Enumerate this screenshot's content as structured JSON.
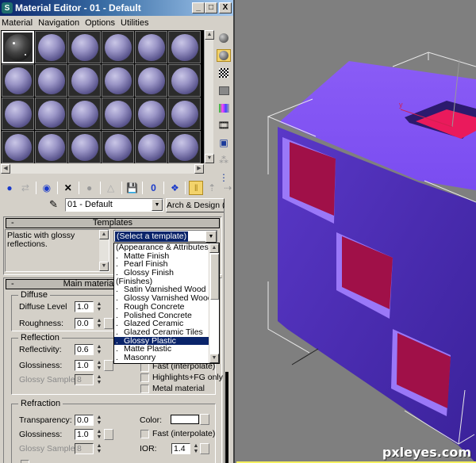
{
  "window": {
    "app_icon": "3ds-max-icon",
    "title": "Material Editor - 01 - Default",
    "buttons": {
      "minimize": "_",
      "maximize": "□",
      "close": "X"
    }
  },
  "menu": [
    "Material",
    "Navigation",
    "Options",
    "Utilities"
  ],
  "sample_slots": {
    "rows": 4,
    "cols": 6,
    "active_index": 0,
    "active_style": "black-glossy",
    "others_style": "lavender-sphere"
  },
  "side_tools": [
    {
      "icon": "sample-type-sphere-icon",
      "active": false
    },
    {
      "icon": "backlight-icon",
      "active": true
    },
    {
      "icon": "background-checker-icon",
      "active": false
    },
    {
      "icon": "sample-uv-tiling-icon",
      "active": false
    },
    {
      "icon": "video-color-check-icon",
      "active": false
    },
    {
      "icon": "make-preview-icon",
      "active": false
    },
    {
      "icon": "options-icon",
      "active": false
    },
    {
      "icon": "select-by-material-icon",
      "active": false
    },
    {
      "icon": "material-map-navigator-icon",
      "active": false
    }
  ],
  "toolbar": [
    {
      "icon": "get-material-icon",
      "active": false
    },
    {
      "icon": "put-material-to-scene-icon",
      "active": false
    },
    {
      "icon": "assign-material-to-selection-icon",
      "active": false
    },
    {
      "icon": "reset-map-icon",
      "active": false
    },
    {
      "icon": "make-material-copy-icon",
      "active": false
    },
    {
      "icon": "make-unique-icon",
      "active": false
    },
    {
      "icon": "put-to-library-icon",
      "active": false
    },
    {
      "icon": "material-id-channel-icon",
      "active": false
    },
    {
      "icon": "show-map-in-viewport-icon",
      "active": false
    },
    {
      "icon": "show-end-result-icon",
      "active": true
    },
    {
      "icon": "go-to-parent-icon",
      "active": false
    },
    {
      "icon": "go-forward-to-sibling-icon",
      "active": false
    }
  ],
  "material_name": "01 - Default",
  "material_type": "Arch & Design (mi)",
  "templates_rollout": {
    "title": "Templates",
    "collapse": "-",
    "description": "Plastic with glossy reflections.",
    "select_value": "(Select a template)",
    "options": [
      {
        "label": "(Appearance & Attributes)",
        "bullet": ""
      },
      {
        "label": "Matte Finish",
        "bullet": "."
      },
      {
        "label": "Pearl Finish",
        "bullet": "."
      },
      {
        "label": "Glossy Finish",
        "bullet": "."
      },
      {
        "label": "(Finishes)",
        "bullet": ""
      },
      {
        "label": "Satin Varnished Wood",
        "bullet": "."
      },
      {
        "label": "Glossy Varnished Wood",
        "bullet": "."
      },
      {
        "label": "Rough Concrete",
        "bullet": "."
      },
      {
        "label": "Polished Concrete",
        "bullet": "."
      },
      {
        "label": "Glazed Ceramic",
        "bullet": "."
      },
      {
        "label": "Glazed Ceramic Tiles",
        "bullet": "."
      },
      {
        "label": "Glossy Plastic",
        "bullet": ".",
        "highlighted": true
      },
      {
        "label": "Matte Plastic",
        "bullet": "."
      },
      {
        "label": "Masonry",
        "bullet": "."
      }
    ]
  },
  "main_rollout": {
    "title": "Main material parameters",
    "title_visible": "Main materi",
    "collapse": "-",
    "diffuse": {
      "label": "Diffuse",
      "diffuse_level_label": "Diffuse Level",
      "diffuse_level": "1.0",
      "roughness_label": "Roughness:",
      "roughness": "0.0"
    },
    "reflection": {
      "label": "Reflection",
      "reflectivity_label": "Reflectivity:",
      "reflectivity": "0.6",
      "glossiness_label": "Glossiness:",
      "glossiness": "1.0",
      "glossy_samples_label": "Glossy Samples:",
      "glossy_samples": "8",
      "fast_label": "Fast (interpolate)",
      "highlights_label": "Highlights+FG only",
      "metal_label": "Metal material"
    },
    "refraction": {
      "label": "Refraction",
      "transparency_label": "Transparency:",
      "transparency": "0.0",
      "glossiness_label": "Glossiness:",
      "glossiness": "1.0",
      "glossy_samples_label": "Glossy Samples:",
      "glossy_samples": "8",
      "color_label": "Color:",
      "color": "#ffffff",
      "fast_label": "Fast (interpolate)",
      "ior_label": "IOR:",
      "ior": "1.4",
      "translucency_label": "Transl"
    }
  },
  "viewport": {
    "axis_label": "y",
    "cube_color": "#7b4ff0",
    "hole_color": "#e8185a",
    "watermark": "pxleyes.com"
  }
}
